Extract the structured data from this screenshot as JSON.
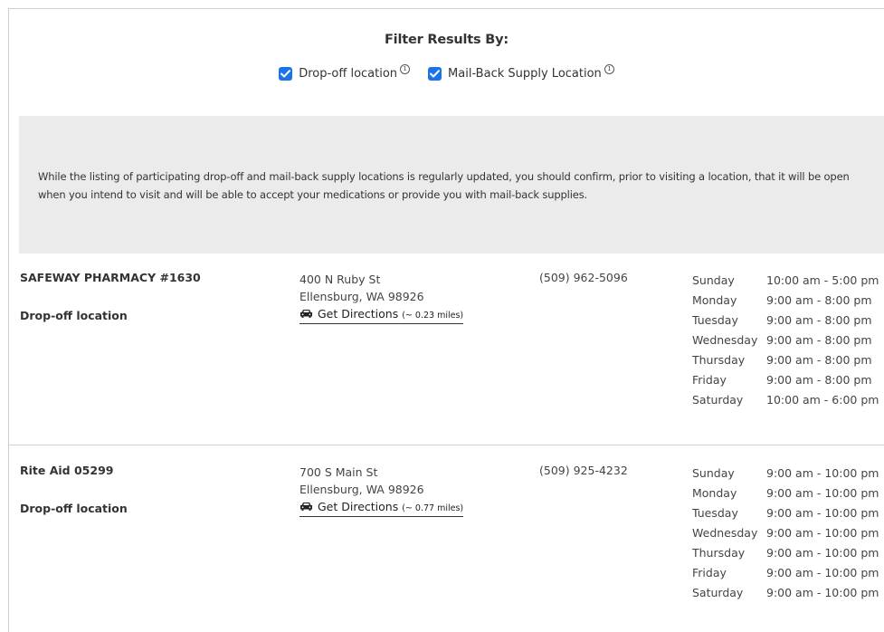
{
  "filter": {
    "title": "Filter Results By:",
    "options": [
      {
        "label": "Drop-off location",
        "checked": true,
        "info": "ⓘ"
      },
      {
        "label": "Mail-Back Supply Location",
        "checked": true,
        "info": "ⓘ"
      }
    ]
  },
  "notice": "While the listing of participating drop-off and mail-back supply locations is regularly updated, you should confirm, prior to visiting a location, that it will be open when you intend to visit and will be able to accept your medications or provide you with mail-back supplies.",
  "locations": [
    {
      "name": "SAFEWAY PHARMACY #1630",
      "type": "Drop-off location",
      "address_line1": "400 N Ruby St",
      "address_line2": "Ellensburg, WA 98926",
      "directions_label": "Get Directions",
      "distance": "(~ 0.23 miles)",
      "phone": "(509) 962-5096",
      "hours": [
        {
          "day": "Sunday",
          "time": "10:00 am - 5:00 pm"
        },
        {
          "day": "Monday",
          "time": "9:00 am - 8:00 pm"
        },
        {
          "day": "Tuesday",
          "time": "9:00 am - 8:00 pm"
        },
        {
          "day": "Wednesday",
          "time": "9:00 am - 8:00 pm"
        },
        {
          "day": "Thursday",
          "time": "9:00 am - 8:00 pm"
        },
        {
          "day": "Friday",
          "time": "9:00 am - 8:00 pm"
        },
        {
          "day": "Saturday",
          "time": "10:00 am - 6:00 pm"
        }
      ]
    },
    {
      "name": "Rite Aid 05299",
      "type": "Drop-off location",
      "address_line1": "700 S Main St",
      "address_line2": "Ellensburg, WA 98926",
      "directions_label": "Get Directions",
      "distance": "(~ 0.77 miles)",
      "phone": "(509) 925-4232",
      "hours": [
        {
          "day": "Sunday",
          "time": "9:00 am - 10:00 pm"
        },
        {
          "day": "Monday",
          "time": "9:00 am - 10:00 pm"
        },
        {
          "day": "Tuesday",
          "time": "9:00 am - 10:00 pm"
        },
        {
          "day": "Wednesday",
          "time": "9:00 am - 10:00 pm"
        },
        {
          "day": "Thursday",
          "time": "9:00 am - 10:00 pm"
        },
        {
          "day": "Friday",
          "time": "9:00 am - 10:00 pm"
        },
        {
          "day": "Saturday",
          "time": "9:00 am - 10:00 pm"
        }
      ]
    }
  ],
  "colors": {
    "checkbox": "#1a73e8",
    "notice_bg": "#ebebeb",
    "text": "#333333",
    "border": "#cfcfcf"
  },
  "icons": {
    "checkbox": "checkbox-checked-icon",
    "info": "info-circle-icon",
    "directions": "car-icon"
  }
}
